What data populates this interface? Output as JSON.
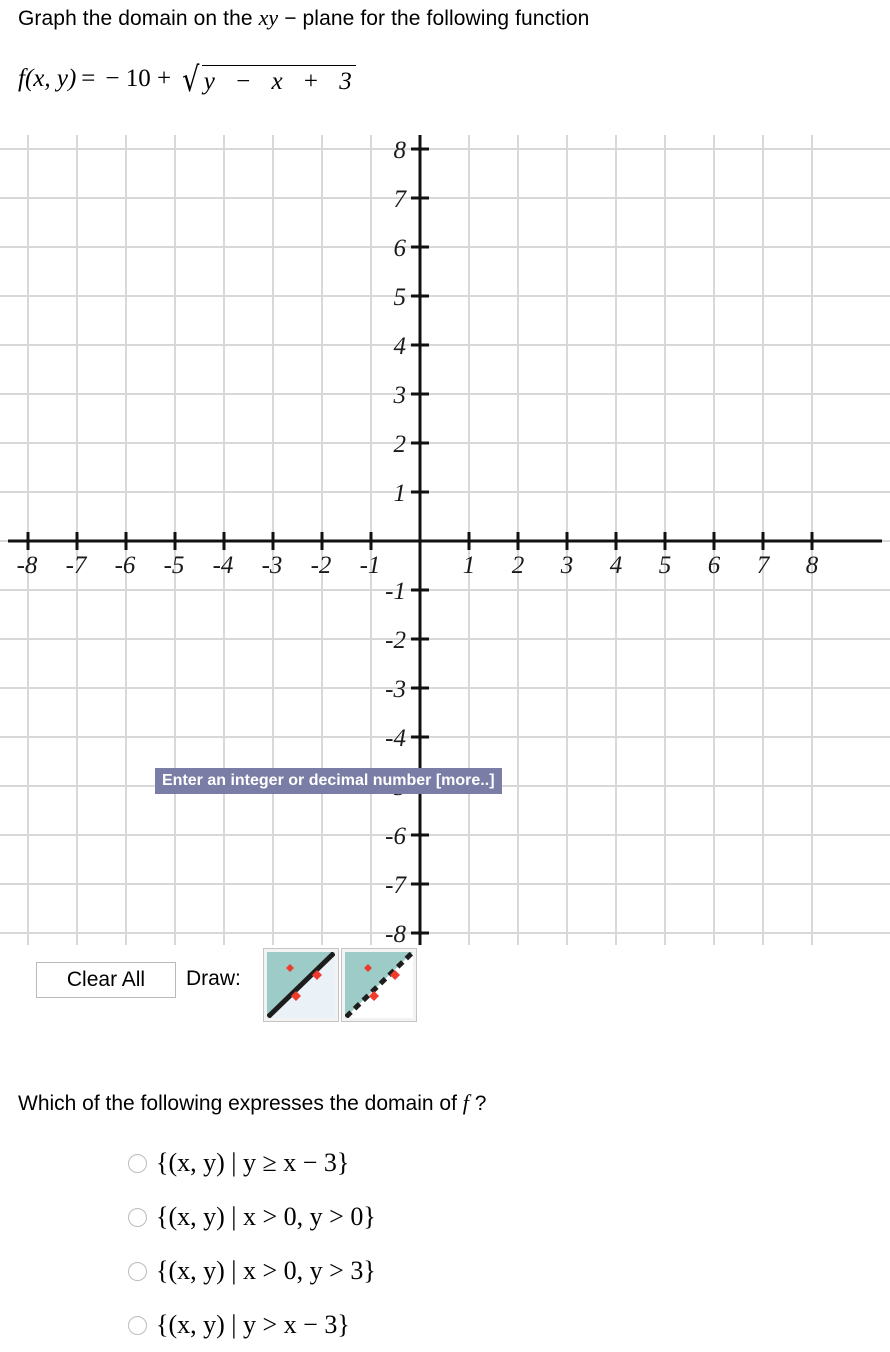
{
  "prompt": {
    "line1_before": "Graph the domain on the ",
    "line1_vars": "xy",
    "line1_after": " − plane for the following function",
    "formula": {
      "fname": "f",
      "args": "(x, y)",
      "equals": "=",
      "leading": "− 10 +",
      "radicand_y": "y",
      "radicand_minus": "−",
      "radicand_x": "x",
      "radicand_plus": "+",
      "radicand_three": "3",
      "plain": "f(x, y) = -10 + sqrt(y - x + 3)"
    }
  },
  "graph": {
    "x_axis_labels": [
      "-8",
      "-7",
      "-6",
      "-5",
      "-4",
      "-3",
      "-2",
      "-1",
      "1",
      "2",
      "3",
      "4",
      "5",
      "6",
      "7",
      "8"
    ],
    "y_axis_labels": [
      "8",
      "7",
      "6",
      "5",
      "4",
      "3",
      "2",
      "1",
      "-1",
      "-2",
      "-3",
      "-4",
      "-5",
      "-6",
      "-7",
      "-8"
    ],
    "x_min": -8,
    "x_max": 8,
    "y_min": -8,
    "y_max": 8,
    "grid_color": "#d8d8d8",
    "axis_color": "#111111",
    "plotted_objects": []
  },
  "tooltip": {
    "text": "Enter an integer or decimal number [more..]",
    "background": "#7a7da6",
    "color": "#ffffff"
  },
  "toolbar": {
    "clear_all_label": "Clear All",
    "draw_label": "Draw:",
    "tools": [
      {
        "name": "solid-line-region-tool",
        "line_style": "solid",
        "shade_color": "#9dccc8",
        "line_color": "#1d1d1d",
        "point_color": "#ee3b2b",
        "unshaded_color": "#eaf2f8"
      },
      {
        "name": "dashed-line-region-tool",
        "line_style": "dashed",
        "shade_color": "#9dccc8",
        "line_color": "#1d1d1d",
        "point_color": "#ee3b2b",
        "unshaded_color": "#ffffff"
      }
    ]
  },
  "question": {
    "text_before": "Which of the following expresses the domain of ",
    "text_var": "f",
    "text_after": " ?",
    "choices": [
      {
        "id": "choice-a",
        "label": "{(x, y) | y ≥ x − 3}",
        "selected": false
      },
      {
        "id": "choice-b",
        "label": "{(x, y) | x > 0, y > 0}",
        "selected": false
      },
      {
        "id": "choice-c",
        "label": "{(x, y) | x > 0, y > 3}",
        "selected": false
      },
      {
        "id": "choice-d",
        "label": "{(x, y) | y > x − 3}",
        "selected": false
      }
    ]
  }
}
